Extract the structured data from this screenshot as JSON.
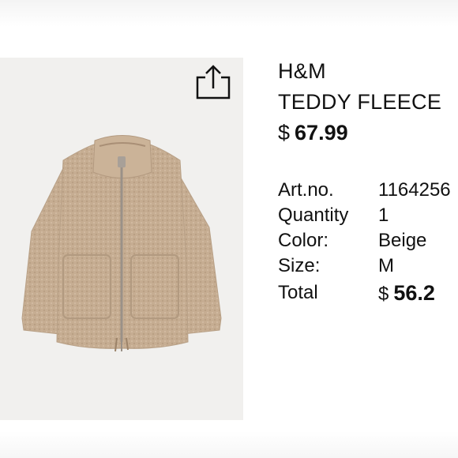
{
  "product": {
    "brand": "H&M",
    "name": "TEDDY FLEECE",
    "price_currency": "$",
    "price_amount": "67.99"
  },
  "details": {
    "art_label": "Art.no.",
    "art_value": "1164256",
    "quantity_label": "Quantity",
    "quantity_value": "1",
    "color_label": "Color:",
    "color_value": "Beige",
    "size_label": "Size:",
    "size_value": "M",
    "total_label": "Total",
    "total_currency": "$",
    "total_amount": "56.2"
  },
  "icons": {
    "share": "share-icon"
  },
  "colors": {
    "image_background": "#f1f0ee",
    "jacket": "#c7ae93"
  }
}
